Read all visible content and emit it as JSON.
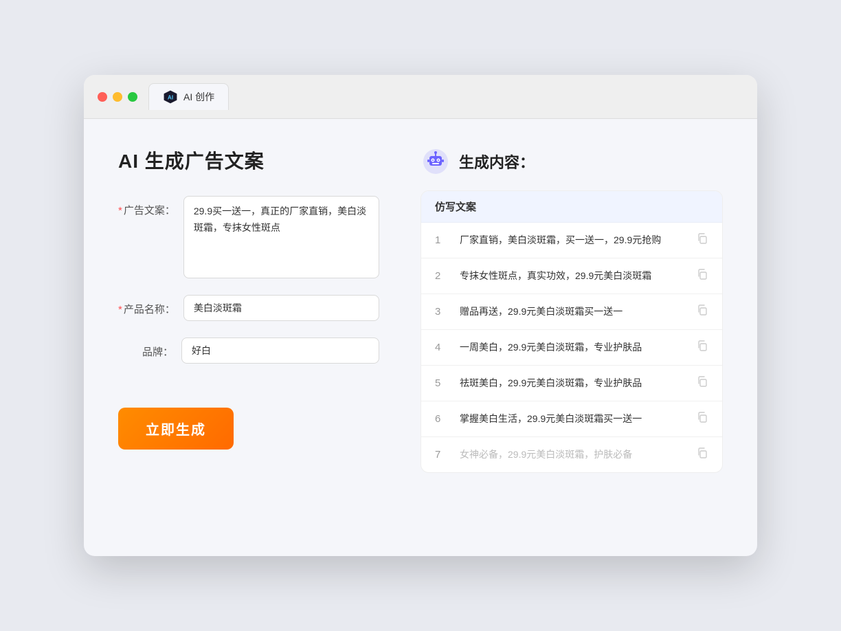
{
  "browser": {
    "tab_label": "AI 创作"
  },
  "page": {
    "title": "AI 生成广告文案",
    "result_title": "生成内容："
  },
  "form": {
    "ad_copy_label": "广告文案：",
    "ad_copy_value": "29.9买一送一，真正的厂家直销，美白淡斑霜，专抹女性斑点",
    "product_name_label": "产品名称：",
    "product_name_value": "美白淡斑霜",
    "brand_label": "品牌：",
    "brand_value": "好白",
    "generate_btn_label": "立即生成"
  },
  "results": {
    "column_label": "仿写文案",
    "items": [
      {
        "num": "1",
        "text": "厂家直销，美白淡斑霜，买一送一，29.9元抢购",
        "faded": false
      },
      {
        "num": "2",
        "text": "专抹女性斑点，真实功效，29.9元美白淡斑霜",
        "faded": false
      },
      {
        "num": "3",
        "text": "赠品再送，29.9元美白淡斑霜买一送一",
        "faded": false
      },
      {
        "num": "4",
        "text": "一周美白，29.9元美白淡斑霜，专业护肤品",
        "faded": false
      },
      {
        "num": "5",
        "text": "祛斑美白，29.9元美白淡斑霜，专业护肤品",
        "faded": false
      },
      {
        "num": "6",
        "text": "掌握美白生活，29.9元美白淡斑霜买一送一",
        "faded": false
      },
      {
        "num": "7",
        "text": "女神必备，29.9元美白淡斑霜，护肤必备",
        "faded": true
      }
    ]
  }
}
